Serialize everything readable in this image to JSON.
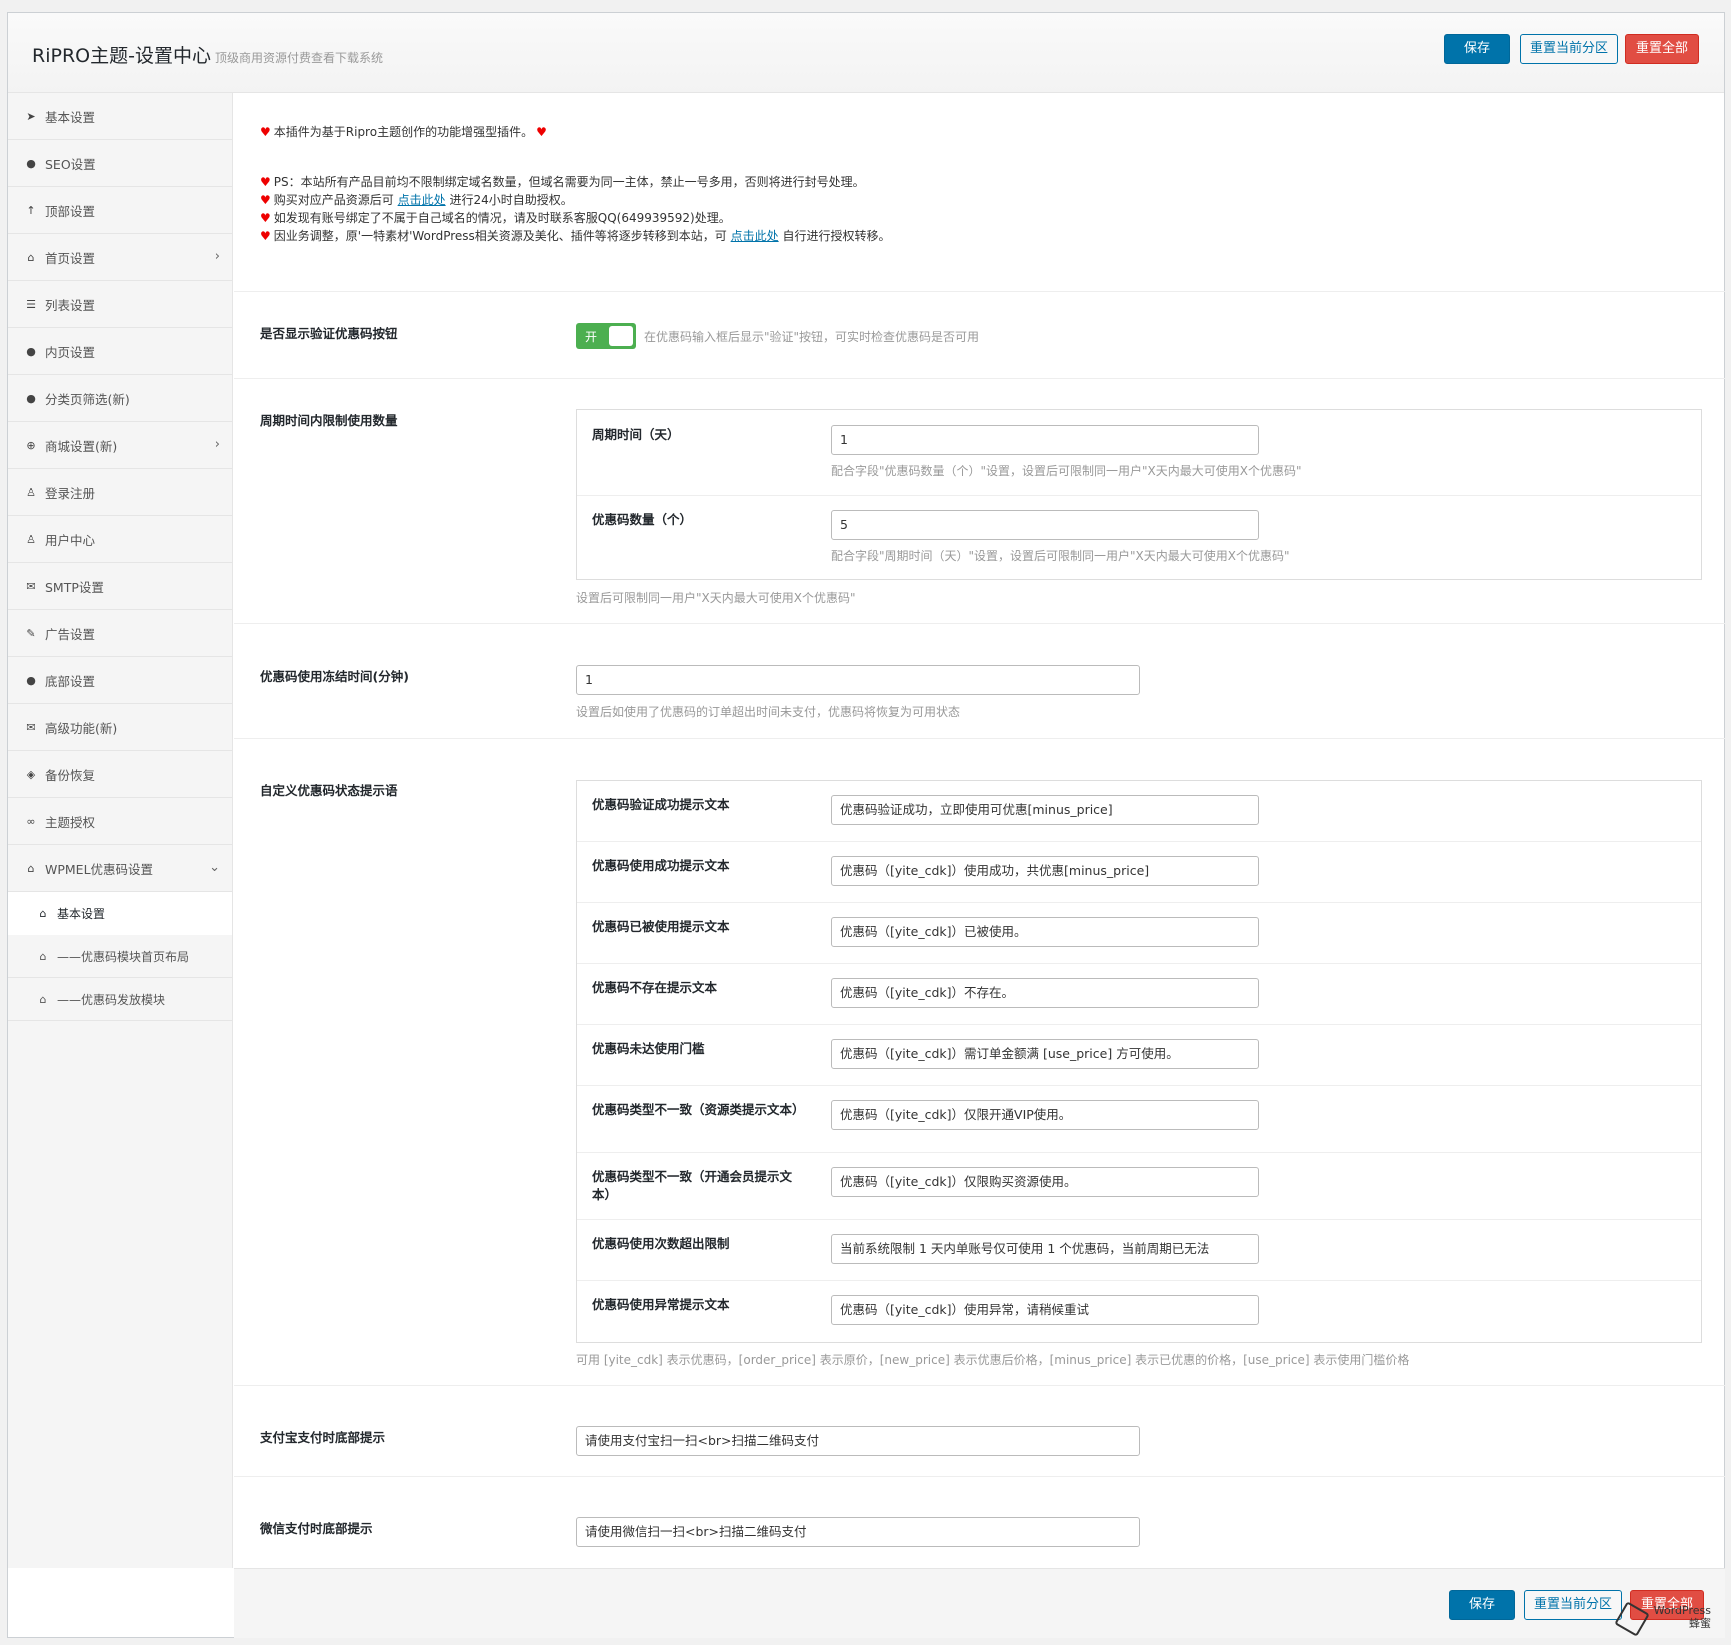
{
  "header": {
    "title": "RiPRO主题-设置中心",
    "subtitle": "顶级商用资源付费查看下载系统",
    "save": "保存",
    "reset_section": "重置当前分区",
    "reset_all": "重置全部"
  },
  "sidebar": {
    "items": [
      {
        "label": "基本设置",
        "icon": "rocket-icon"
      },
      {
        "label": "SEO设置",
        "icon": "circle-icon"
      },
      {
        "label": "顶部设置",
        "icon": "arrow-up-icon"
      },
      {
        "label": "首页设置",
        "icon": "home-icon"
      },
      {
        "label": "列表设置",
        "icon": "list-icon"
      },
      {
        "label": "内页设置",
        "icon": "circle-icon"
      },
      {
        "label": "分类页筛选(新)",
        "icon": "circle-icon"
      },
      {
        "label": "商城设置(新)",
        "icon": "plus-circle-icon"
      },
      {
        "label": "登录注册",
        "icon": "user-icon"
      },
      {
        "label": "用户中心",
        "icon": "user-icon"
      },
      {
        "label": "SMTP设置",
        "icon": "envelope-icon"
      },
      {
        "label": "广告设置",
        "icon": "wrench-icon"
      },
      {
        "label": "底部设置",
        "icon": "circle-icon"
      },
      {
        "label": "高级功能(新)",
        "icon": "envelope-icon"
      },
      {
        "label": "备份恢复",
        "icon": "shield-icon"
      },
      {
        "label": "主题授权",
        "icon": "handshake-icon"
      },
      {
        "label": "WPMEL优惠码设置",
        "icon": "home-icon"
      }
    ],
    "sub_items": [
      {
        "label": "基本设置"
      },
      {
        "label": "——优惠码模块首页布局"
      },
      {
        "label": "——优惠码发放模块"
      }
    ]
  },
  "notice": {
    "line1": "本插件为基于Ripro主题创作的功能增强型插件。",
    "line2": "PS：本站所有产品目前均不限制绑定域名数量，但域名需要为同一主体，禁止一号多用，否则将进行封号处理。",
    "line3_pre": "购买对应产品资源后可",
    "line3_link": "点击此处",
    "line3_post": "进行24小时自助授权。",
    "line4": "如发现有账号绑定了不属于自己域名的情况，请及时联系客服QQ(649939592)处理。",
    "line5_pre": "因业务调整，原'一特素材'WordPress相关资源及美化、插件等将逐步转移到本站，可",
    "line5_link": "点击此处",
    "line5_post": "自行进行授权转移。"
  },
  "fields": {
    "show_verify": {
      "label": "是否显示验证优惠码按钮",
      "toggle": "开",
      "desc": "在优惠码输入框后显示\"验证\"按钮，可实时检查优惠码是否可用"
    },
    "period_limit": {
      "label": "周期时间内限制使用数量",
      "days_label": "周期时间（天）",
      "days_value": "1",
      "days_desc": "配合字段\"优惠码数量（个）\"设置，设置后可限制同一用户\"X天内最大可使用X个优惠码\"",
      "count_label": "优惠码数量（个）",
      "count_value": "5",
      "count_desc": "配合字段\"周期时间（天）\"设置，设置后可限制同一用户\"X天内最大可使用X个优惠码\"",
      "desc": "设置后可限制同一用户\"X天内最大可使用X个优惠码\""
    },
    "freeze": {
      "label": "优惠码使用冻结时间(分钟)",
      "value": "1",
      "desc": "设置后如使用了优惠码的订单超出时间未支付，优惠码将恢复为可用状态"
    },
    "messages": {
      "label": "自定义优惠码状态提示语",
      "rows": [
        {
          "label": "优惠码验证成功提示文本",
          "value": "优惠码验证成功，立即使用可优惠[minus_price]"
        },
        {
          "label": "优惠码使用成功提示文本",
          "value": "优惠码（[yite_cdk]）使用成功，共优惠[minus_price]"
        },
        {
          "label": "优惠码已被使用提示文本",
          "value": "优惠码（[yite_cdk]）已被使用。"
        },
        {
          "label": "优惠码不存在提示文本",
          "value": "优惠码（[yite_cdk]）不存在。"
        },
        {
          "label": "优惠码未达使用门槛",
          "value": "优惠码（[yite_cdk]）需订单金额满 [use_price] 方可使用。"
        },
        {
          "label": "优惠码类型不一致（资源类提示文本）",
          "value": "优惠码（[yite_cdk]）仅限开通VIP使用。"
        },
        {
          "label": "优惠码类型不一致（开通会员提示文本）",
          "value": "优惠码（[yite_cdk]）仅限购买资源使用。"
        },
        {
          "label": "优惠码使用次数超出限制",
          "value": "当前系统限制 1 天内单账号仅可使用 1 个优惠码，当前周期已无法"
        },
        {
          "label": "优惠码使用异常提示文本",
          "value": "优惠码（[yite_cdk]）使用异常，请稍候重试"
        }
      ],
      "desc": "可用 [yite_cdk] 表示优惠码，[order_price] 表示原价，[new_price] 表示优惠后价格，[minus_price] 表示已优惠的价格，[use_price] 表示使用门槛价格"
    },
    "alipay": {
      "label": "支付宝支付时底部提示",
      "value": "请使用支付宝扫一扫<br>扫描二维码支付"
    },
    "wechat": {
      "label": "微信支付时底部提示",
      "value": "请使用微信扫一扫<br>扫描二维码支付"
    }
  },
  "footer": {
    "save": "保存",
    "reset_section": "重置当前分区",
    "reset_all": "重置全部",
    "watermark_line1": "WordPress",
    "watermark_line2": "蜂蜜"
  }
}
